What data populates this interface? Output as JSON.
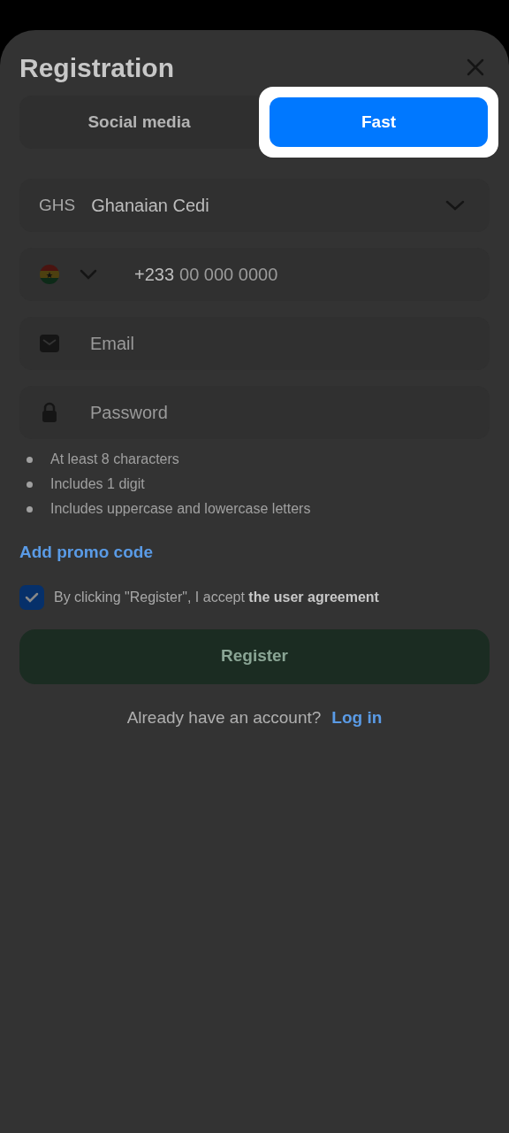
{
  "title": "Registration",
  "tabs": [
    {
      "label": "Social media",
      "selected": false
    },
    {
      "label": "Fast",
      "selected": true
    }
  ],
  "currency": {
    "code": "GHS",
    "name": "Ghanaian Cedi"
  },
  "phone": {
    "prefix": "+233",
    "placeholder": "00 000 0000"
  },
  "email": {
    "placeholder": "Email"
  },
  "password": {
    "placeholder": "Password"
  },
  "requirements": [
    "At least 8 characters",
    "Includes 1 digit",
    "Includes uppercase and lowercase letters"
  ],
  "promo_link": "Add promo code",
  "agreement": {
    "checked": true,
    "text": "By clicking \"Register\", I accept **the user agreement**"
  },
  "register": {
    "label": "Register",
    "disabled": true
  },
  "login_prompt": {
    "text": "Already have an account?",
    "link": "Log in"
  }
}
